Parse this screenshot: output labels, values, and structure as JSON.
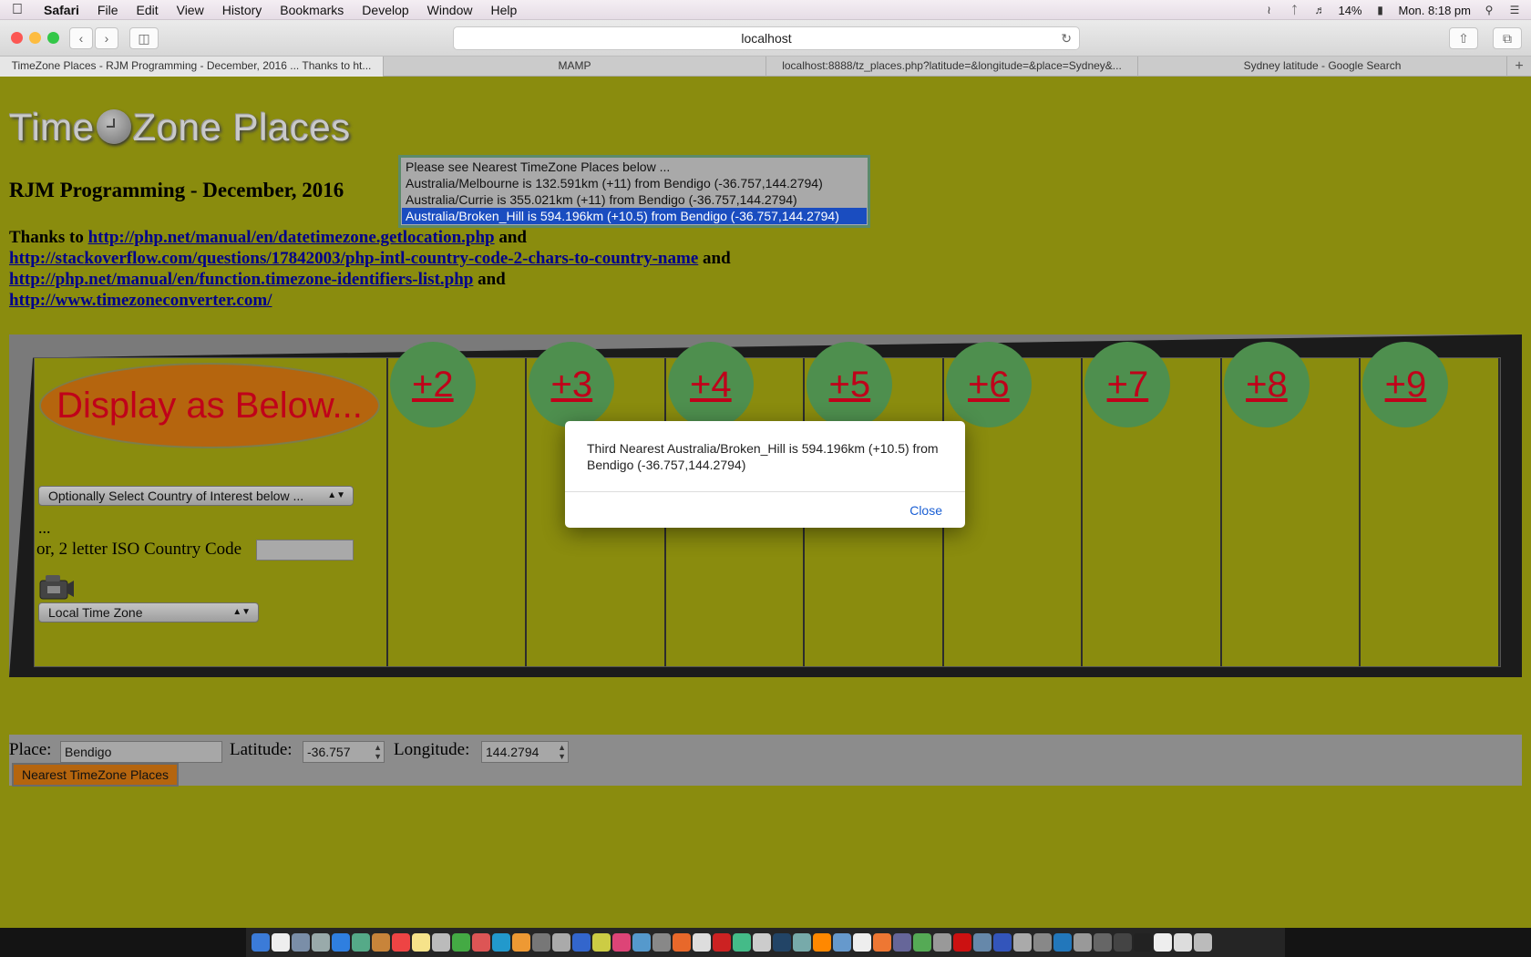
{
  "menubar": {
    "apple": "",
    "app": "Safari",
    "items": [
      "File",
      "Edit",
      "View",
      "History",
      "Bookmarks",
      "Develop",
      "Window",
      "Help"
    ],
    "battery": "14%",
    "datetime": "Mon. 8:18 pm"
  },
  "browser": {
    "url": "localhost",
    "tabs": [
      "TimeZone Places - RJM Programming - December, 2016 ... Thanks to ht...",
      "MAMP",
      "localhost:8888/tz_places.php?latitude=&longitude=&place=Sydney&...",
      "Sydney latitude - Google Search"
    ]
  },
  "page": {
    "logo": {
      "left": "Time",
      "right": "Zone Places"
    },
    "subtitle": "RJM Programming - December, 2016",
    "thanks_prefix": "Thanks to",
    "and": "and",
    "links": [
      "http://php.net/manual/en/datetimezone.getlocation.php",
      "http://stackoverflow.com/questions/17842003/php-intl-country-code-2-chars-to-country-name",
      "http://php.net/manual/en/function.timezone-identifiers-list.php",
      "http://www.timezoneconverter.com/"
    ],
    "nearest_list": [
      "Please see Nearest TimeZone Places below ...",
      "Australia/Melbourne is 132.591km (+11) from Bendigo (-36.757,144.2794)",
      "Australia/Currie is 355.021km (+11) from Bendigo (-36.757,144.2794)",
      "Australia/Broken_Hill is 594.196km (+10.5) from Bendigo (-36.757,144.2794)"
    ],
    "display_button": "Display as Below...",
    "country_select": "Optionally Select Country of Interest below ...",
    "dots": "...",
    "iso_label": "or, 2 letter ISO Country Code",
    "tz_select": "Local Time Zone",
    "zones": [
      "+2",
      "+3",
      "+4",
      "+5",
      "+6",
      "+7",
      "+8",
      "+9"
    ],
    "form": {
      "place_label": "Place:",
      "place_value": "Bendigo",
      "lat_label": "Latitude:",
      "lat_value": "-36.757",
      "lon_label": "Longitude:",
      "lon_value": "144.2794",
      "button": "Nearest TimeZone Places"
    }
  },
  "modal": {
    "message": "Third Nearest Australia/Broken_Hill is 594.196km (+10.5) from Bendigo (-36.757,144.2794)",
    "close": "Close"
  }
}
